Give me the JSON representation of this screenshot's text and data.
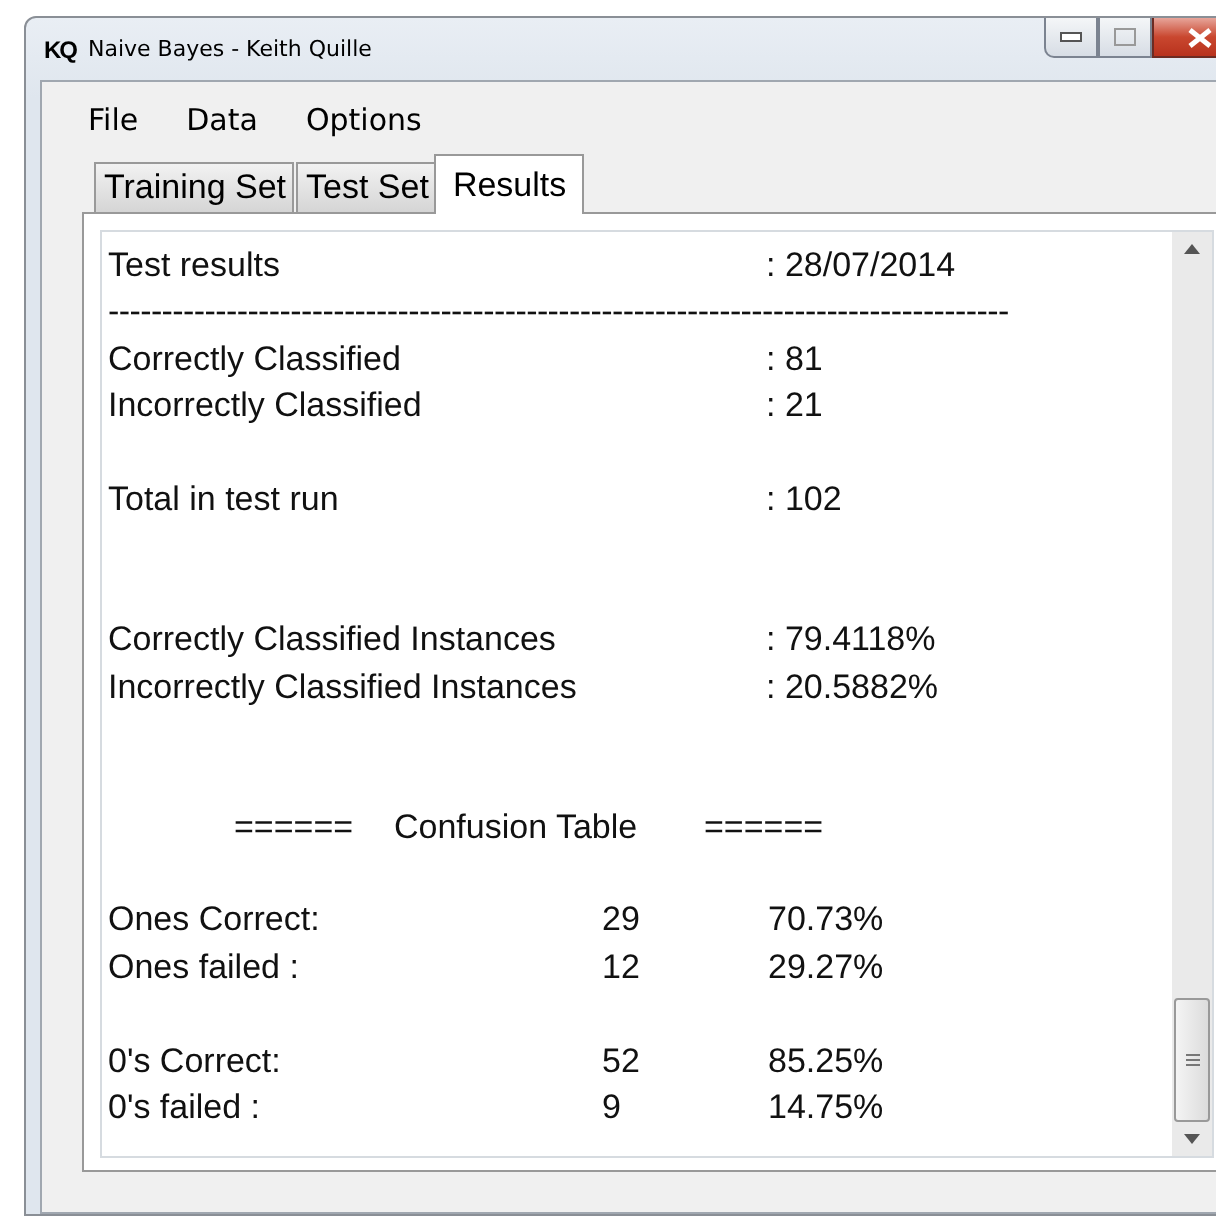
{
  "window": {
    "title": "Naive Bayes - Keith Quille",
    "logo": "KQ"
  },
  "menu": [
    "File",
    "Data",
    "Options"
  ],
  "tabs": [
    {
      "label": "Training Set",
      "selected": false
    },
    {
      "label": "Test Set",
      "selected": false
    },
    {
      "label": "Results",
      "selected": true
    }
  ],
  "results": [
    {
      "kind": "pair",
      "label": "Test results",
      "value": ": 28/07/2014"
    },
    {
      "kind": "rule",
      "text": "------------------------------------------------------------------------------------"
    },
    {
      "kind": "pair",
      "label": "Correctly Classified",
      "value": ": 81"
    },
    {
      "kind": "pair",
      "label": "Incorrectly Classified",
      "value": ": 21"
    },
    {
      "kind": "blank"
    },
    {
      "kind": "pair",
      "label": "Total in test run",
      "value": ": 102"
    },
    {
      "kind": "blank"
    },
    {
      "kind": "blank"
    },
    {
      "kind": "pair",
      "label": "Correctly Classified Instances",
      "value": ": 79.4118%"
    },
    {
      "kind": "pair",
      "label": "Incorrectly Classified Instances",
      "value": ": 20.5882%"
    },
    {
      "kind": "blank"
    },
    {
      "kind": "blank"
    },
    {
      "kind": "heading",
      "left": "======",
      "title": "Confusion Table",
      "right": "======"
    },
    {
      "kind": "blank"
    },
    {
      "kind": "triple",
      "label": "Ones Correct:",
      "count": "29",
      "percent": "70.73%"
    },
    {
      "kind": "triple",
      "label": "Ones failed :",
      "count": "12",
      "percent": "29.27%"
    },
    {
      "kind": "blank"
    },
    {
      "kind": "triple",
      "label": "0's Correct:",
      "count": "52",
      "percent": "85.25%"
    },
    {
      "kind": "triple",
      "label": "0's failed :",
      "count": "9",
      "percent": "14.75%"
    }
  ]
}
